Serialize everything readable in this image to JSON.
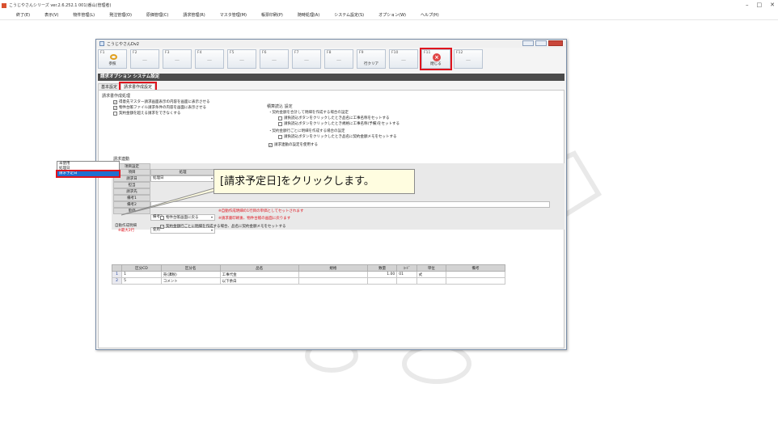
{
  "app": {
    "title": "こうじやさんシリーズ ver.2.6.252.1 001(番山(管理者)",
    "window_controls": [
      "–",
      "□",
      "✕"
    ]
  },
  "menu": [
    "終了(E)",
    "表示(V)",
    "物件管理(L)",
    "発注管理(O)",
    "原価管理(C)",
    "請求管理(R)",
    "マスタ管理(M)",
    "帳票印刷(P)",
    "随時処理(A)",
    "システム設定(S)",
    "オプション(W)",
    "ヘルプ(H)"
  ],
  "dialog": {
    "title": "こうじやさんDv2",
    "fkeys": [
      {
        "fn": "F1",
        "label": "参照",
        "icon": "key-icon"
      },
      {
        "fn": "F2",
        "label": "—"
      },
      {
        "fn": "F3",
        "label": "—"
      },
      {
        "fn": "F4",
        "label": "—"
      },
      {
        "fn": "F5",
        "label": "—"
      },
      {
        "fn": "F6",
        "label": "—"
      },
      {
        "fn": "F7",
        "label": "—"
      },
      {
        "fn": "F8",
        "label": "—"
      },
      {
        "fn": "F9",
        "label": "行クリア"
      },
      {
        "fn": "F10",
        "label": "—"
      },
      {
        "fn": "F11",
        "label": "閉じる",
        "icon": "close-icon"
      },
      {
        "fn": "F12",
        "label": "—"
      }
    ],
    "section_title": "請求オプション システム設定",
    "tabs": [
      "基本設定",
      "請求書作成設定"
    ],
    "invoice_group": {
      "title": "請求書作成処理",
      "checks": [
        {
          "label": "得意先マスター請求画面表示の内容を画面に表示させる",
          "checked": true
        },
        {
          "label": "物件台帳ファイル請求条件の内容を画面に表示させる",
          "checked": true
        },
        {
          "label": "契約金額を超える請求をできなくする",
          "checked": false
        }
      ]
    },
    "estimate_group": {
      "title": "積算読込 設定",
      "line1": "・契約金額を合計して明細を作成する場合の設定",
      "line1a": "請負読込ボタンをクリックしたとき品名に工事名称をセットする",
      "line1b": "請負読込ボタンをクリックしたとき規格に工事名称(予備)をセットする",
      "line2": "・契約金額行ごとに明細を作成する場合の設定",
      "line2a": "請負読込ボタンをクリックしたとき品名に契約金額メモをセットする",
      "use_label": "請求連動の設定を使用する"
    },
    "link_group": {
      "title": "請求連動",
      "subtitle": "項目設定",
      "col_item": "項目",
      "col_proc": "処理",
      "rows": [
        {
          "label": "請求日",
          "value": "処理日"
        },
        {
          "label": "担当",
          "value": ""
        },
        {
          "label": "請求先",
          "value": ""
        },
        {
          "label": "備考1",
          "value": ""
        },
        {
          "label": "備考2",
          "value": "備考2"
        },
        {
          "label": "単価",
          "value": "使用"
        }
      ],
      "unit_note": "※自動作成明細の1行目の単価としてセットされます",
      "return_check": "物件台帳画面に戻る",
      "return_note": "※請求書印刷後、物件台帳の画面に戻ります",
      "auto_label": "自動作成明細",
      "auto_max": "※最大2行",
      "auto_check": "契約金額行ごとに明細を作成する場合、品名に契約金額メモをセットする"
    },
    "dropdown": {
      "options": [
        "未使用",
        "処理日",
        "請求予定日"
      ],
      "selected": "請求予定日"
    },
    "callout": "[請求予定日]をクリックします。",
    "detail_table": {
      "headers": [
        "",
        "区分CD",
        "区分名",
        "品名",
        "規格",
        "数量",
        "ｺｰﾄﾞ",
        "単位",
        "備考"
      ],
      "rows": [
        [
          "1",
          "1",
          "売(課税)",
          "工事代金",
          "",
          "1.00",
          "01",
          "式",
          ""
        ],
        [
          "2",
          "5",
          "コメント",
          "以下余白",
          "",
          "",
          "",
          "",
          ""
        ]
      ]
    }
  }
}
